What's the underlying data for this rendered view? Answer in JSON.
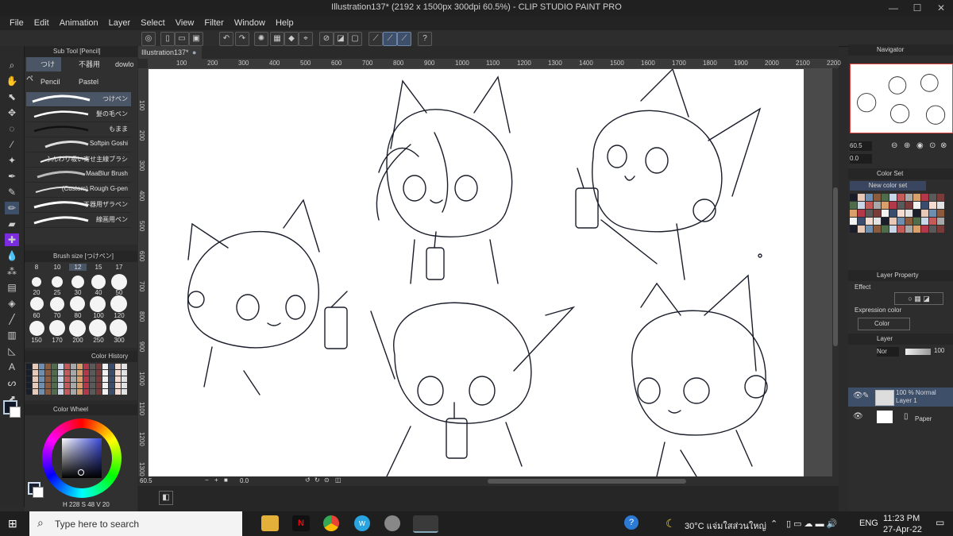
{
  "window": {
    "title": "Illustration137* (2192 x 1500px 300dpi 60.5%)  - CLIP STUDIO PAINT PRO",
    "controls": [
      "—",
      "☐",
      "✕"
    ]
  },
  "menu": [
    "File",
    "Edit",
    "Animation",
    "Layer",
    "Select",
    "View",
    "Filter",
    "Window",
    "Help"
  ],
  "subtool": {
    "header": "Sub Tool [Pencil]",
    "tabs": [
      "つけペ",
      "不器用",
      "dowlo",
      "Pencil",
      "Pastel"
    ],
    "brushes": [
      "つけペン",
      "髪の毛ペン",
      "もまま",
      "Softpin Goshi",
      "ふんわり吸い寄せ主線ブラシ",
      "MaaBlur Brush",
      "(Custom) Rough G-pen",
      "不器用ザラペン",
      "線画用ペン"
    ]
  },
  "brush_size": {
    "header": "Brush size [つけペン]",
    "sizes": [
      "8",
      "10",
      "12",
      "15",
      "17",
      "20",
      "25",
      "30",
      "40",
      "50",
      "60",
      "70",
      "80",
      "100",
      "120",
      "150",
      "170",
      "200",
      "250",
      "300"
    ]
  },
  "color_history": {
    "header": "Color History"
  },
  "color_wheel": {
    "header": "Color Wheel",
    "h": "228",
    "s": "48",
    "v": "20",
    "h_label": "H",
    "s_label": "S",
    "v_label": "V"
  },
  "document": {
    "tab": "Illustration137*"
  },
  "ruler_h": [
    "100",
    "200",
    "300",
    "400",
    "500",
    "600",
    "700",
    "800",
    "900",
    "1000",
    "1100",
    "1200",
    "1300",
    "1400",
    "1500",
    "1600",
    "1700",
    "1800",
    "1900",
    "2000",
    "2100",
    "2200"
  ],
  "ruler_v": [
    "100",
    "200",
    "300",
    "400",
    "500",
    "600",
    "700",
    "800",
    "900",
    "1000",
    "1100",
    "1200",
    "1300"
  ],
  "status": {
    "zoom": "60.5",
    "angle": "0.0"
  },
  "navigator": {
    "header": "Navigator",
    "zoom": "60.5",
    "rotate": "0.0"
  },
  "color_set": {
    "header": "Color Set",
    "name": "New color set"
  },
  "layer_property": {
    "header": "Layer Property",
    "effect_label": "Effect",
    "expression_label": "Expression color",
    "expression_value": "Color"
  },
  "layers": {
    "header": "Layer",
    "blend": "Nor",
    "opacity": "100",
    "items": [
      {
        "line1": "100 % Normal",
        "line2": "Layer 1"
      },
      {
        "line1": "",
        "line2": "Paper"
      }
    ]
  },
  "taskbar": {
    "search_placeholder": "Type here to search",
    "weather": "30°C  แจ่มใสส่วนใหญ่",
    "lang": "ENG",
    "time": "11:23 PM",
    "date": "27-Apr-22"
  },
  "colors": {
    "accent": "#3e4f6a",
    "canvas": "#ffffff",
    "taskbar": "#1f1f1f"
  }
}
